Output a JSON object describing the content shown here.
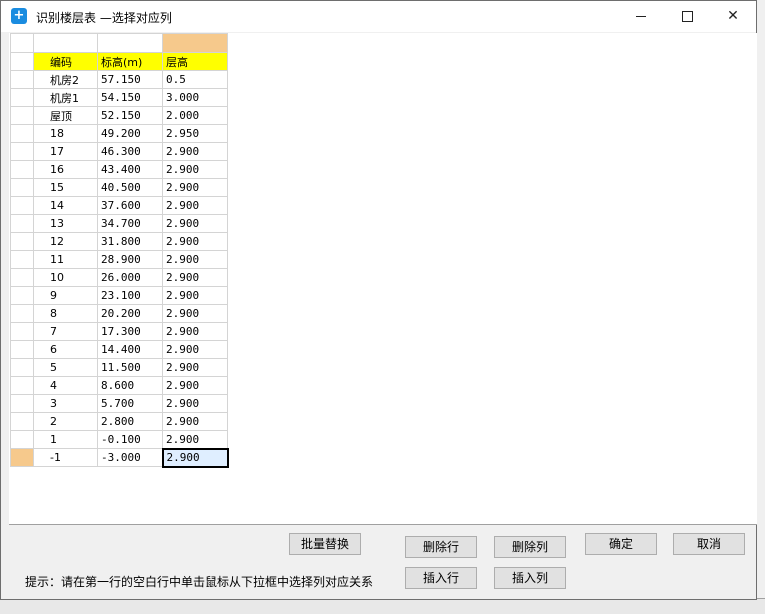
{
  "window": {
    "title": "识别楼层表 —选择对应列"
  },
  "table": {
    "headers": [
      "编码",
      "标高(m)",
      "层高"
    ],
    "rows": [
      [
        "机房2",
        "57.150",
        "0.5"
      ],
      [
        "机房1",
        "54.150",
        "3.000"
      ],
      [
        "屋顶",
        "52.150",
        "2.000"
      ],
      [
        "18",
        "49.200",
        "2.950"
      ],
      [
        "17",
        "46.300",
        "2.900"
      ],
      [
        "16",
        "43.400",
        "2.900"
      ],
      [
        "15",
        "40.500",
        "2.900"
      ],
      [
        "14",
        "37.600",
        "2.900"
      ],
      [
        "13",
        "34.700",
        "2.900"
      ],
      [
        "12",
        "31.800",
        "2.900"
      ],
      [
        "11",
        "28.900",
        "2.900"
      ],
      [
        "10",
        "26.000",
        "2.900"
      ],
      [
        "9",
        "23.100",
        "2.900"
      ],
      [
        "8",
        "20.200",
        "2.900"
      ],
      [
        "7",
        "17.300",
        "2.900"
      ],
      [
        "6",
        "14.400",
        "2.900"
      ],
      [
        "5",
        "11.500",
        "2.900"
      ],
      [
        "4",
        "8.600",
        "2.900"
      ],
      [
        "3",
        "5.700",
        "2.900"
      ],
      [
        "2",
        "2.800",
        "2.900"
      ],
      [
        "1",
        "-0.100",
        "2.900"
      ],
      [
        "-1",
        "-3.000",
        "2.900"
      ]
    ]
  },
  "buttons": {
    "batch_replace": "批量替换",
    "delete_row": "删除行",
    "delete_column": "删除列",
    "insert_row": "插入行",
    "insert_column": "插入列",
    "ok": "确定",
    "cancel": "取消"
  },
  "hint": "提示：请在第一行的空白行中单击鼠标从下拉框中选择列对应关系",
  "colors": {
    "header_fill": "#ffff00",
    "selected_fill": "#f6c98c",
    "app_icon": "#1a8ce0"
  },
  "icons": {
    "app": "app-logo-icon",
    "minimize": "minimize-icon",
    "maximize": "maximize-icon",
    "close": "close-icon"
  }
}
